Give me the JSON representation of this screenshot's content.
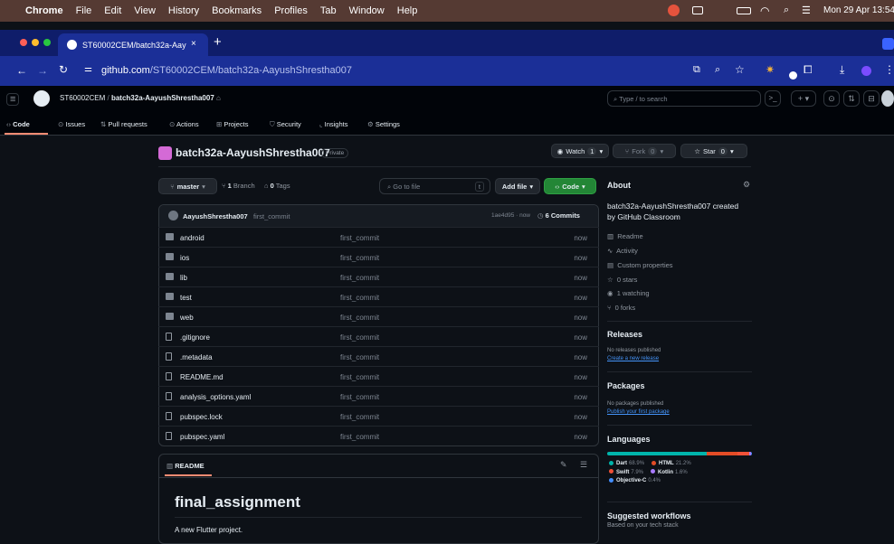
{
  "mac_menu": {
    "app": "Chrome",
    "items": [
      "File",
      "Edit",
      "View",
      "History",
      "Bookmarks",
      "Profiles",
      "Tab",
      "Window",
      "Help"
    ],
    "clock": "Mon 29 Apr 13:54"
  },
  "browser": {
    "tab_title": "ST60002CEM/batch32a-Aay",
    "url_host": "github.com",
    "url_path": "/ST60002CEM/batch32a-AayushShrestha007"
  },
  "gh": {
    "breadcrumb_org": "ST60002CEM",
    "breadcrumb_sep": "/",
    "breadcrumb_repo": "batch32a-AayushShrestha007",
    "search_placeholder": "Type / to search",
    "tabs": [
      "Code",
      "Issues",
      "Pull requests",
      "Actions",
      "Projects",
      "Security",
      "Insights",
      "Settings"
    ],
    "repo_name": "batch32a-AayushShrestha007",
    "visibility": "Private",
    "watch": "Watch",
    "watch_count": "1",
    "fork": "Fork",
    "fork_count": "0",
    "star": "Star",
    "star_count": "0",
    "branch": "master",
    "branch_count": "1",
    "branch_word": "Branch",
    "tags_count": "0",
    "tags_word": "Tags",
    "goto_placeholder": "Go to file",
    "goto_key": "t",
    "add_file": "Add file",
    "code_btn": "Code",
    "commit_author": "AayushShrestha007",
    "commit_msg": "first_commit",
    "commit_hash": "1ae4d95 · now",
    "commits": "6 Commits",
    "files": [
      {
        "name": "android",
        "type": "folder",
        "msg": "first_commit",
        "time": "now"
      },
      {
        "name": "ios",
        "type": "folder",
        "msg": "first_commit",
        "time": "now"
      },
      {
        "name": "lib",
        "type": "folder",
        "msg": "first_commit",
        "time": "now"
      },
      {
        "name": "test",
        "type": "folder",
        "msg": "first_commit",
        "time": "now"
      },
      {
        "name": "web",
        "type": "folder",
        "msg": "first_commit",
        "time": "now"
      },
      {
        "name": ".gitignore",
        "type": "file",
        "msg": "first_commit",
        "time": "now"
      },
      {
        "name": ".metadata",
        "type": "file",
        "msg": "first_commit",
        "time": "now"
      },
      {
        "name": "README.md",
        "type": "file",
        "msg": "first_commit",
        "time": "now"
      },
      {
        "name": "analysis_options.yaml",
        "type": "file",
        "msg": "first_commit",
        "time": "now"
      },
      {
        "name": "pubspec.lock",
        "type": "file",
        "msg": "first_commit",
        "time": "now"
      },
      {
        "name": "pubspec.yaml",
        "type": "file",
        "msg": "first_commit",
        "time": "now"
      }
    ],
    "readme_tab": "README",
    "readme_title": "final_assignment",
    "readme_text": "A new Flutter project.",
    "about": {
      "title": "About",
      "desc_line1": "batch32a-AayushShrestha007 created",
      "desc_line2": "by GitHub Classroom",
      "items": [
        "Readme",
        "Activity",
        "Custom properties",
        "0 stars",
        "1 watching",
        "0 forks"
      ]
    },
    "releases": {
      "title": "Releases",
      "none": "No releases published",
      "link": "Create a new release"
    },
    "packages": {
      "title": "Packages",
      "none": "No packages published",
      "link": "Publish your first package"
    },
    "languages": {
      "title": "Languages",
      "list": [
        {
          "name": "Dart",
          "pct": "68.9%",
          "value": 68.9,
          "color": "#00b4ab"
        },
        {
          "name": "HTML",
          "pct": "21.2%",
          "value": 21.2,
          "color": "#e34c26"
        },
        {
          "name": "Swift",
          "pct": "7.9%",
          "value": 7.9,
          "color": "#f05138"
        },
        {
          "name": "Kotlin",
          "pct": "1.6%",
          "value": 1.6,
          "color": "#a97bff"
        },
        {
          "name": "Objective-C",
          "pct": "0.4%",
          "value": 0.4,
          "color": "#438eff"
        }
      ]
    },
    "workflows": {
      "title": "Suggested workflows",
      "sub": "Based on your tech stack"
    }
  }
}
